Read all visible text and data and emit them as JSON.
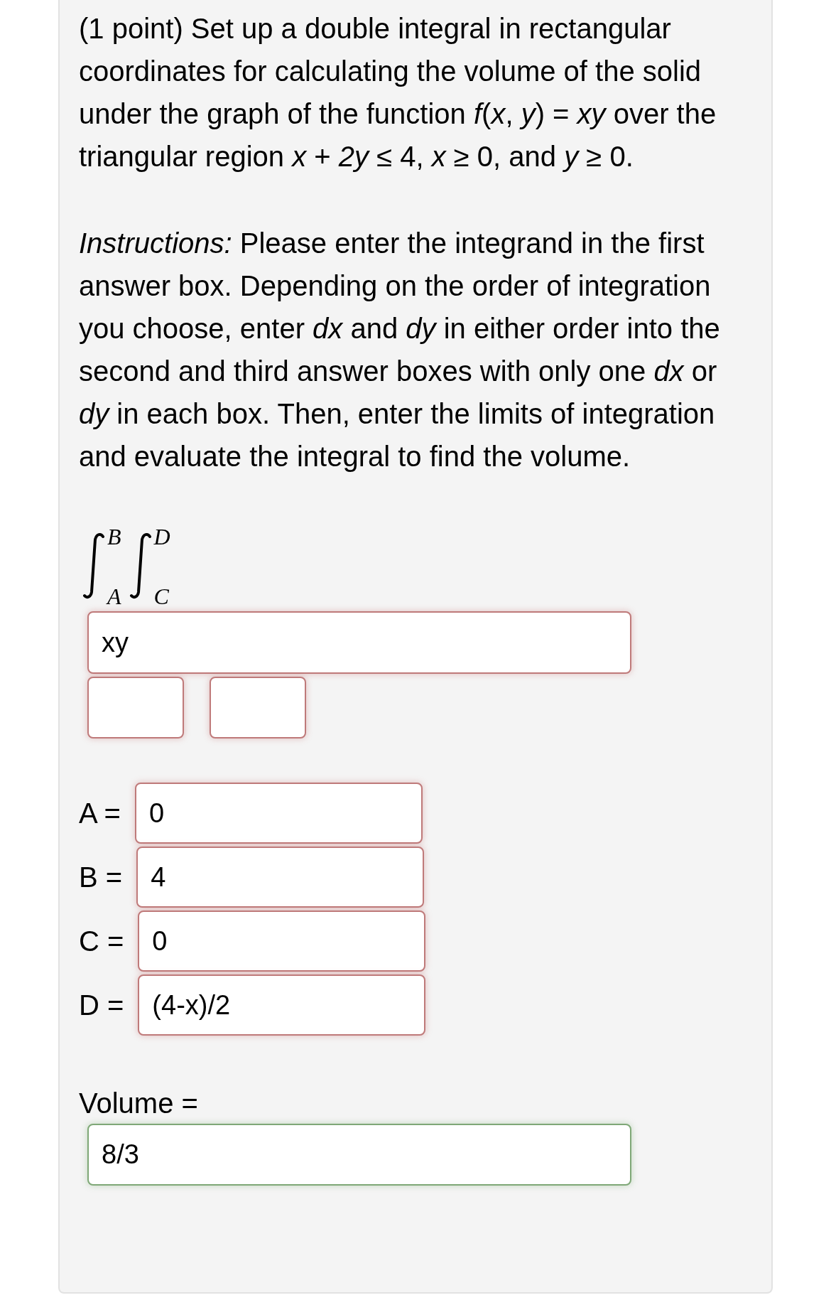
{
  "problem": "(1 point) Set up a double integral in rectangular coordinates for calculating the volume of the solid under the graph of the function *f*(*x*, *y*) = *xy* over the triangular region *x* + *2y* ≤ 4, *x* ≥ 0, and *y* ≥ 0.",
  "instructions": "*Instructions:* Please enter the integrand in the first answer box. Depending on the order of integration you choose, enter *dx* and *dy* in either order into the second and third answer boxes with only one *dx* or *dy* in each box. Then, enter the limits of integration and evaluate the integral to find the volume.",
  "integral": {
    "outer_lower": "A",
    "outer_upper": "B",
    "inner_lower": "C",
    "inner_upper": "D"
  },
  "integrand": {
    "value": "xy",
    "correct": false
  },
  "differentials": [
    {
      "correct": false
    },
    {
      "correct": false
    }
  ],
  "limits": [
    {
      "label": "A =",
      "value": "0",
      "correct": false
    },
    {
      "label": "B =",
      "value": "4",
      "correct": false
    },
    {
      "label": "C =",
      "value": "0",
      "correct": false
    },
    {
      "label": "D =",
      "value": "(4-x)/2",
      "correct": false
    }
  ],
  "volume": {
    "label": "Volume =",
    "value": "8/3",
    "correct": true
  }
}
